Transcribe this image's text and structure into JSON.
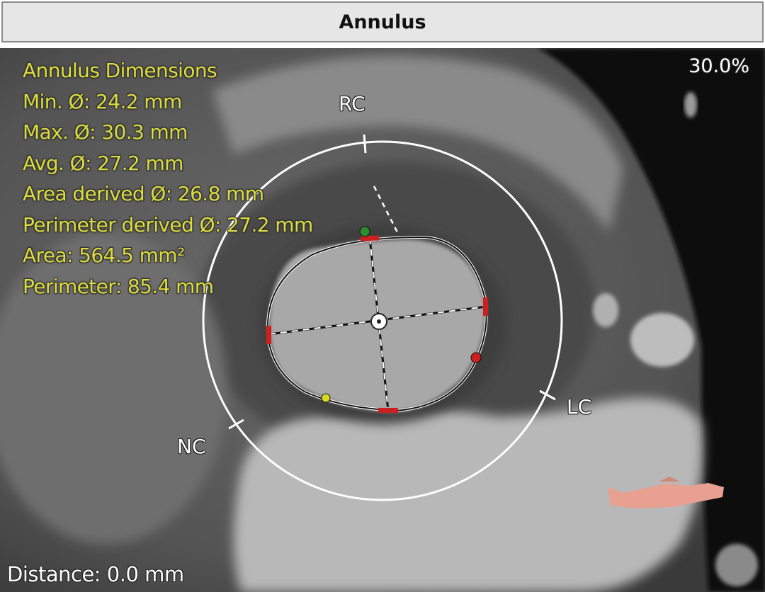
{
  "panel": {
    "title": "Annulus"
  },
  "viewport": {
    "zoom": "30.0%",
    "distance": "Distance: 0.0 mm",
    "dimensions": {
      "heading": "Annulus Dimensions",
      "lines": [
        "Min. Ø: 24.2 mm",
        "Max. Ø: 30.3 mm",
        "Avg. Ø: 27.2 mm",
        "Area derived Ø: 26.8 mm",
        "Perimeter derived Ø: 27.2 mm",
        "Area: 564.5 mm²",
        "Perimeter: 85.4 mm"
      ]
    },
    "cusps": {
      "rc": "RC",
      "lc": "LC",
      "nc": "NC"
    }
  },
  "colors": {
    "overlay_text": "#dcdc40",
    "ring": "#ffffff",
    "contour": "#111111",
    "marker_red": "#cc2020",
    "marker_green": "#2e8b2e",
    "marker_yellow": "#d8d820",
    "model_3d": "#e8a090"
  }
}
